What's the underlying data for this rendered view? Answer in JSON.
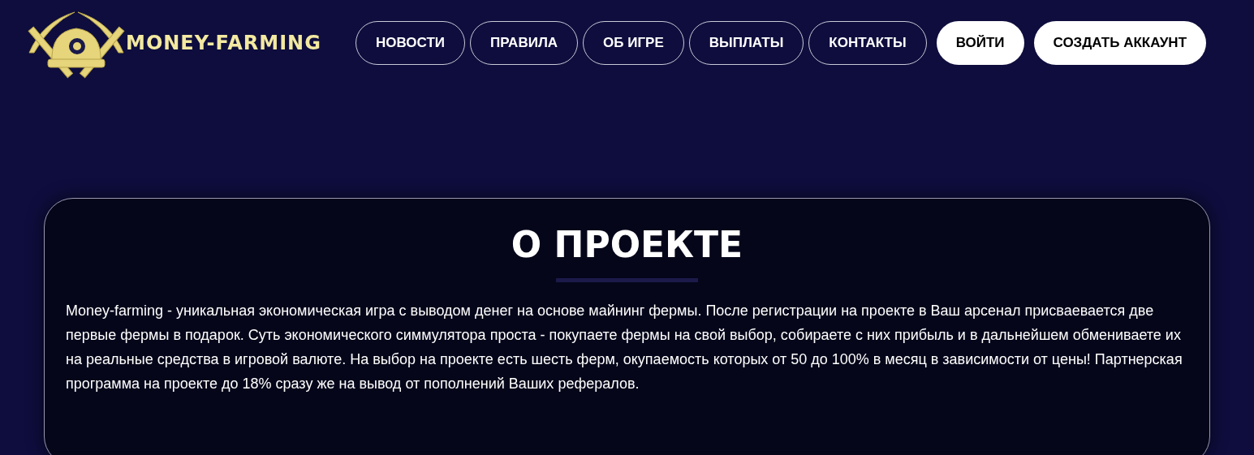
{
  "logo": {
    "text": "MONEY-FARMING"
  },
  "nav": [
    {
      "label": "НОВОСТИ",
      "kind": "outline"
    },
    {
      "label": "ПРАВИЛА",
      "kind": "outline"
    },
    {
      "label": "ОБ ИГРЕ",
      "kind": "outline"
    },
    {
      "label": "ВЫПЛАТЫ",
      "kind": "outline"
    },
    {
      "label": "КОНТАКТЫ",
      "kind": "outline"
    },
    {
      "label": "ВОЙТИ",
      "kind": "filled"
    },
    {
      "label": "СОЗДАТЬ АККАУНТ",
      "kind": "filled"
    }
  ],
  "about": {
    "title": "О ПРОЕКТЕ",
    "text": "Money-farming - уникальная экономическая игра с выводом денег на основе майнинг фермы. После регистрации на проекте в Ваш арсенал присваевается две первые фермы в подарок. Суть экономического симмулятора проста - покупаете фермы на свой выбор, собираете с них прибыль и в дальнейшем обмениваете их на реальные средства в игровой валюте. На выбор на проекте есть шесть ферм, окупаемость которых от 50 до 100% в месяц в зависимости от цены! Партнерская программа на проекте до 18% сразу же на вывод от пополнений Ваших рефералов."
  }
}
